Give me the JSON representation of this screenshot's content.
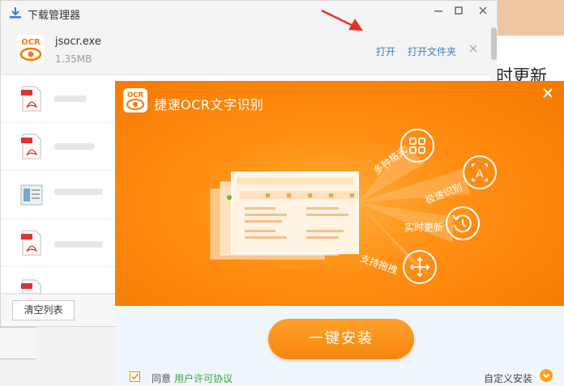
{
  "download_manager": {
    "title": "下载管理器",
    "item": {
      "file_name": "jsocr.exe",
      "file_size": "1.35MB",
      "open_label": "打开",
      "open_folder_label": "打开文件夹"
    },
    "clear_list_label": "清空列表"
  },
  "background_page": {
    "heading_fragment": "时更新"
  },
  "installer": {
    "logo_text": "OCR",
    "title": "捷速OCR文字识别",
    "features": [
      {
        "label": "多种格式",
        "icon": "grid-icon"
      },
      {
        "label": "极速识别",
        "icon": "text-scan-icon"
      },
      {
        "label": "实时更新",
        "icon": "refresh-clock-icon"
      },
      {
        "label": "支持拖拽",
        "icon": "move-arrows-icon"
      }
    ],
    "install_button": "一键安装",
    "agree_label": "同意",
    "license_link": "用户许可协议",
    "custom_install": "自定义安装",
    "accent_color": "#ff8c10",
    "agree_checked": true
  }
}
